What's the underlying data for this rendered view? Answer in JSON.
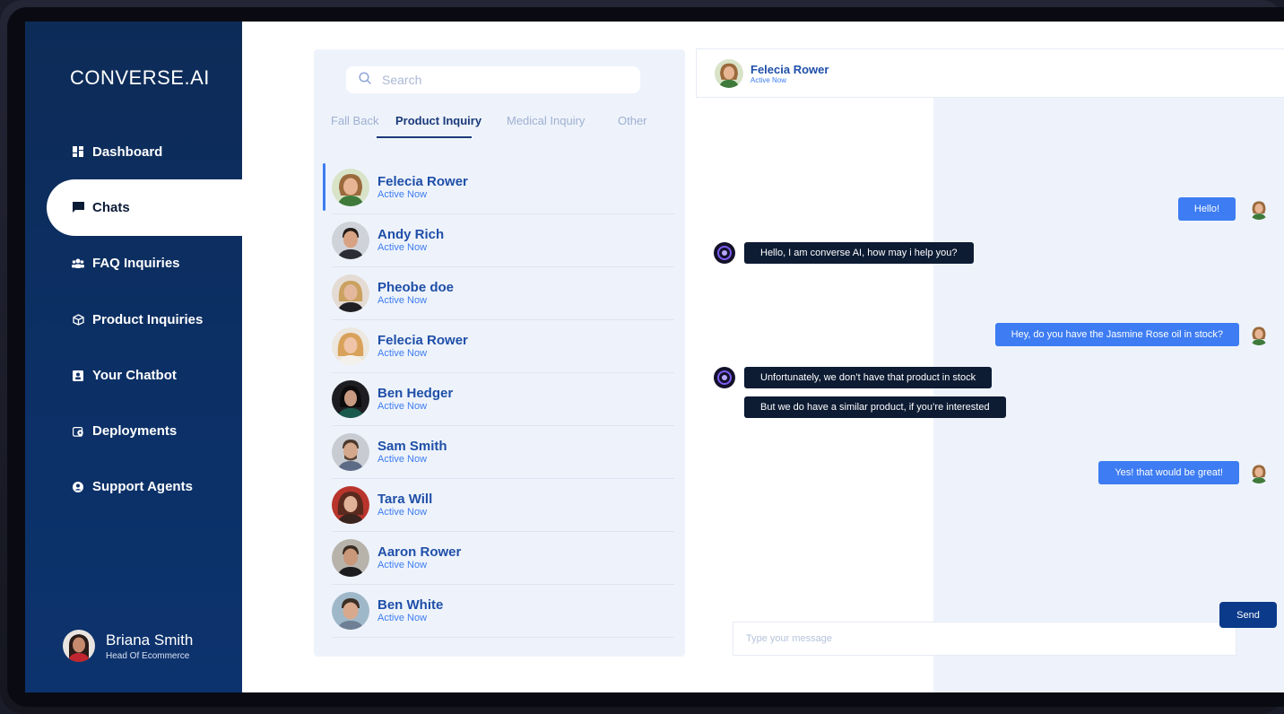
{
  "brand": {
    "logo_text": "CONVERSE.AI"
  },
  "sidebar": {
    "items": [
      {
        "label": "Dashboard",
        "icon": "dashboard-icon",
        "active": false
      },
      {
        "label": "Chats",
        "icon": "chat-icon",
        "active": true
      },
      {
        "label": "FAQ Inquiries",
        "icon": "users-icon",
        "active": false
      },
      {
        "label": "Product Inquiries",
        "icon": "box-icon",
        "active": false
      },
      {
        "label": "Your Chatbot",
        "icon": "bot-badge-icon",
        "active": false
      },
      {
        "label": "Deployments",
        "icon": "deploy-icon",
        "active": false
      },
      {
        "label": "Support Agents",
        "icon": "agent-icon",
        "active": false
      }
    ],
    "profile": {
      "name": "Briana Smith",
      "role": "Head Of Ecommerce"
    }
  },
  "list": {
    "search_placeholder": "Search",
    "tabs": [
      "Fall Back",
      "Product Inquiry",
      "Medical Inquiry",
      "Other"
    ],
    "active_tab": "Product Inquiry",
    "contacts": [
      {
        "name": "Felecia Rower",
        "status": "Active Now"
      },
      {
        "name": "Andy Rich",
        "status": "Active Now"
      },
      {
        "name": "Pheobe doe",
        "status": "Active Now"
      },
      {
        "name": "Felecia Rower",
        "status": "Active Now"
      },
      {
        "name": "Ben Hedger",
        "status": "Active Now"
      },
      {
        "name": "Sam Smith",
        "status": "Active Now"
      },
      {
        "name": "Tara Will",
        "status": "Active Now"
      },
      {
        "name": "Aaron Rower",
        "status": "Active Now"
      },
      {
        "name": "Ben White",
        "status": "Active Now"
      }
    ]
  },
  "chat": {
    "header": {
      "name": "Felecia Rower",
      "status": "Active Now"
    },
    "messages": [
      {
        "from": "user",
        "text": "Hello!"
      },
      {
        "from": "bot",
        "text": "Hello, I am converse AI, how may i help you?"
      },
      {
        "from": "user",
        "text": "Hey, do you have the Jasmine Rose oil in stock?"
      },
      {
        "from": "bot",
        "text": "Unfortunately, we don’t have that product in stock"
      },
      {
        "from": "bot",
        "text": "But we do have a similar product, if you’re interested"
      },
      {
        "from": "user",
        "text": "Yes! that would be great!"
      }
    ],
    "input_placeholder": "Type your message",
    "send_label": "Send"
  },
  "colors": {
    "sidebar": "#0c3066",
    "accent": "#3d7cf2",
    "bot_bubble": "#0d1b33",
    "name_text": "#1f4fa8"
  }
}
